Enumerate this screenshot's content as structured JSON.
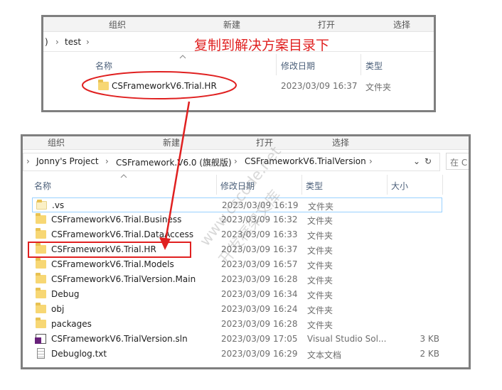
{
  "top_window": {
    "ribbon": [
      "组织",
      "新建",
      "打开",
      "选择"
    ],
    "breadcrumb_prefix": ")",
    "breadcrumb": "test",
    "annotation": "复制到解决方案目录下",
    "columns": {
      "name": "名称",
      "modified": "修改日期",
      "type": "类型"
    },
    "rows": [
      {
        "name": "CSFrameworkV6.Trial.HR",
        "date": "2023/03/09 16:37",
        "type": "文件夹"
      }
    ]
  },
  "bottom_window": {
    "ribbon": [
      "组织",
      "新建",
      "打开",
      "选择"
    ],
    "breadcrumb": [
      "Jonny's Project",
      "CSFramework.V6.0 (旗舰版)",
      "CSFrameworkV6.TrialVersion"
    ],
    "search_placeholder": "在 C",
    "columns": {
      "name": "名称",
      "modified": "修改日期",
      "type": "类型",
      "size": "大小"
    },
    "rows": [
      {
        "name": ".vs",
        "date": "2023/03/09 16:19",
        "type": "文件夹",
        "size": "",
        "icon": "folder-pale-icon"
      },
      {
        "name": "CSFrameworkV6.Trial.Business",
        "date": "2023/03/09 16:32",
        "type": "文件夹",
        "size": "",
        "icon": "folder-icon"
      },
      {
        "name": "CSFrameworkV6.Trial.DataAccess",
        "date": "2023/03/09 16:33",
        "type": "文件夹",
        "size": "",
        "icon": "folder-icon"
      },
      {
        "name": "CSFrameworkV6.Trial.HR",
        "date": "2023/03/09 16:37",
        "type": "文件夹",
        "size": "",
        "icon": "folder-icon"
      },
      {
        "name": "CSFrameworkV6.Trial.Models",
        "date": "2023/03/09 16:57",
        "type": "文件夹",
        "size": "",
        "icon": "folder-icon"
      },
      {
        "name": "CSFrameworkV6.TrialVersion.Main",
        "date": "2023/03/09 16:28",
        "type": "文件夹",
        "size": "",
        "icon": "folder-icon"
      },
      {
        "name": "Debug",
        "date": "2023/03/09 16:34",
        "type": "文件夹",
        "size": "",
        "icon": "folder-icon"
      },
      {
        "name": "obj",
        "date": "2023/03/09 16:24",
        "type": "文件夹",
        "size": "",
        "icon": "folder-icon"
      },
      {
        "name": "packages",
        "date": "2023/03/09 16:28",
        "type": "文件夹",
        "size": "",
        "icon": "folder-icon"
      },
      {
        "name": "CSFrameworkV6.TrialVersion.sln",
        "date": "2023/03/09 17:05",
        "type": "Visual Studio Sol...",
        "size": "3 KB",
        "icon": "vs-solution-icon"
      },
      {
        "name": "Debuglog.txt",
        "date": "2023/03/09 16:29",
        "type": "文本文档",
        "size": "2 KB",
        "icon": "text-file-icon"
      }
    ]
  },
  "watermark": [
    "www.cscode.net",
    "开发框架文库"
  ],
  "colors": {
    "annotation_red": "#e02020",
    "frame_gray": "#7f7f7f",
    "folder_yellow": "#f7d774",
    "selection_blue": "#99d1ff"
  }
}
